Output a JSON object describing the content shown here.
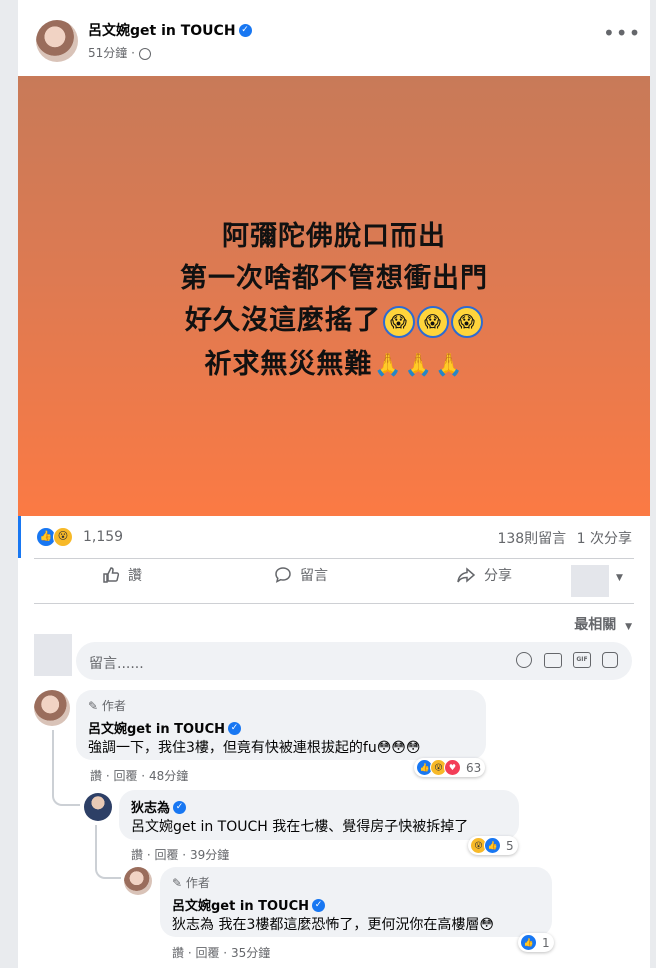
{
  "post": {
    "author": "呂文婉get in TOUCH",
    "time": "51分鐘",
    "audience_icon": "globe-icon",
    "lines": [
      "阿彌陀佛脫口而出",
      "第一次啥都不管想衝出門",
      "好久沒這麼搖了",
      "祈求無災無難"
    ],
    "bg_top": "#c87a58",
    "bg_bottom": "#fb7a44"
  },
  "stats": {
    "reactions_count": "1,159",
    "comments": "138則留言",
    "shares": "1 次分享"
  },
  "actions": {
    "like": "讚",
    "comment": "留言",
    "share": "分享"
  },
  "sort": {
    "label": "最相關"
  },
  "composer": {
    "placeholder": "留言......"
  },
  "comments": [
    {
      "badge": "作者",
      "author": "呂文婉get in TOUCH",
      "text": "強調一下，我住3樓，但竟有快被連根拔起的fu😳😳😳",
      "like": "讚",
      "reply": "回覆",
      "time": "48分鐘",
      "reaction_count": "63"
    },
    {
      "author": "狄志為",
      "text": "呂文婉get in TOUCH 我在七樓、覺得房子快被拆掉了",
      "like": "讚",
      "reply": "回覆",
      "time": "39分鐘",
      "reaction_count": "5"
    },
    {
      "badge": "作者",
      "author": "呂文婉get in TOUCH",
      "text": "狄志為 我在3樓都這麼恐怖了，更何況你在高樓層😳",
      "like": "讚",
      "reply": "回覆",
      "time": "35分鐘",
      "reaction_count": "1"
    }
  ],
  "colors": {
    "accent": "#1877f2",
    "muted": "#65676b"
  }
}
